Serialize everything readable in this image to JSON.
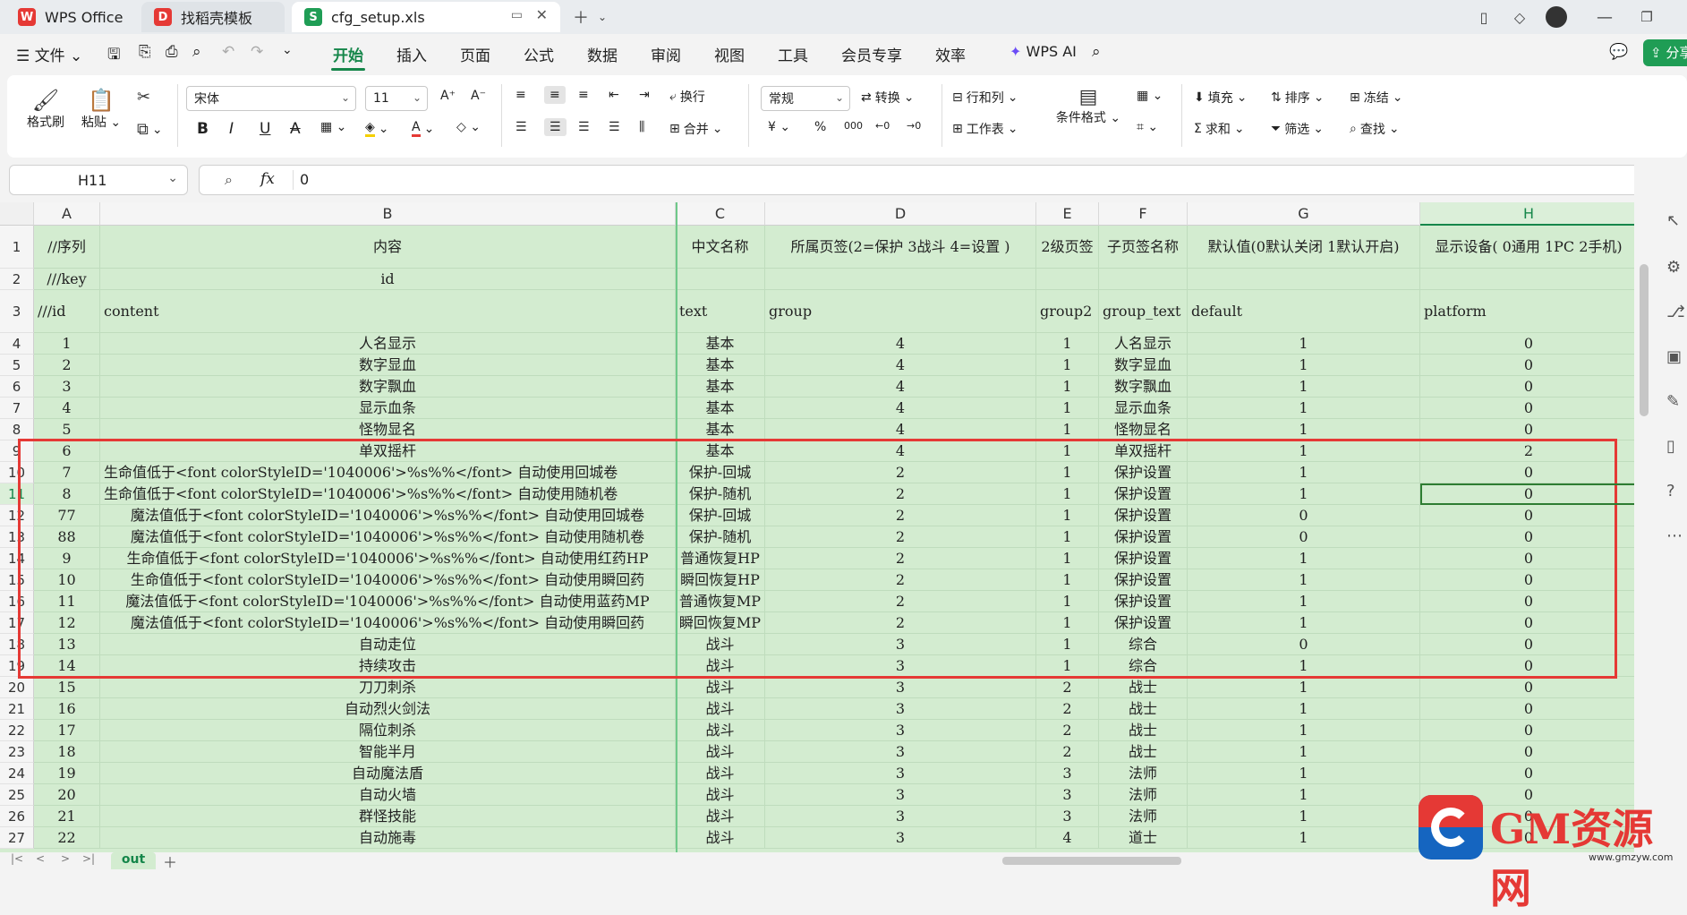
{
  "tabs": [
    {
      "label": "WPS Office"
    },
    {
      "label": "找稻壳模板"
    },
    {
      "label": "cfg_setup.xls"
    }
  ],
  "menu": {
    "file_label": "文件",
    "items": [
      "开始",
      "插入",
      "页面",
      "公式",
      "数据",
      "审阅",
      "视图",
      "工具",
      "会员专享",
      "效率"
    ],
    "wps_ai": "WPS AI",
    "share": "分享"
  },
  "ribbon": {
    "format_painter": "格式刷",
    "paste": "粘贴",
    "font_name": "宋体",
    "font_size": "11",
    "wrap": "换行",
    "merge": "合并",
    "number_format": "常规",
    "convert": "转换",
    "row_col": "行和列",
    "worksheet": "工作表",
    "cond_format": "条件格式",
    "fill": "填充",
    "sort": "排序",
    "freeze": "冻结",
    "sum": "求和",
    "filter": "筛选",
    "find": "查找"
  },
  "formula": {
    "cell_ref": "H11",
    "fx": "fx",
    "value": "0"
  },
  "columns": [
    "A",
    "B",
    "C",
    "D",
    "E",
    "F",
    "G",
    "H"
  ],
  "header_rows": [
    {
      "num": "1",
      "cells": [
        "//序列",
        "内容",
        "中文名称",
        "所属页签(2=保护 3战斗 4=设置 )",
        "2级页签",
        "子页签名称",
        "默认值(0默认关闭 1默认开启)",
        "显示设备( 0通用 1PC 2手机)"
      ]
    },
    {
      "num": "2",
      "cells": [
        "///key",
        "id",
        "",
        "",
        "",
        "",
        "",
        ""
      ]
    },
    {
      "num": "3",
      "cells": [
        "///id",
        "content",
        "text",
        "group",
        "group2",
        "group_text",
        "default",
        "platform"
      ]
    }
  ],
  "rows": [
    {
      "num": "4",
      "cells": [
        "1",
        "人名显示",
        "基本",
        "4",
        "1",
        "人名显示",
        "1",
        "0"
      ]
    },
    {
      "num": "5",
      "cells": [
        "2",
        "数字显血",
        "基本",
        "4",
        "1",
        "数字显血",
        "1",
        "0"
      ]
    },
    {
      "num": "6",
      "cells": [
        "3",
        "数字飘血",
        "基本",
        "4",
        "1",
        "数字飘血",
        "1",
        "0"
      ]
    },
    {
      "num": "7",
      "cells": [
        "4",
        "显示血条",
        "基本",
        "4",
        "1",
        "显示血条",
        "1",
        "0"
      ]
    },
    {
      "num": "8",
      "cells": [
        "5",
        "怪物显名",
        "基本",
        "4",
        "1",
        "怪物显名",
        "1",
        "0"
      ]
    },
    {
      "num": "9",
      "cells": [
        "6",
        "单双摇杆",
        "基本",
        "4",
        "1",
        "单双摇杆",
        "1",
        "2"
      ]
    },
    {
      "num": "10",
      "cells": [
        "7",
        "生命值低于<font colorStyleID='1040006'>%s%%</font> 自动使用回城卷",
        "保护-回城",
        "2",
        "1",
        "保护设置",
        "1",
        "0"
      ]
    },
    {
      "num": "11",
      "cells": [
        "8",
        "生命值低于<font colorStyleID='1040006'>%s%%</font> 自动使用随机卷",
        "保护-随机",
        "2",
        "1",
        "保护设置",
        "1",
        "0"
      ]
    },
    {
      "num": "12",
      "cells": [
        "77",
        "魔法值低于<font colorStyleID='1040006'>%s%%</font> 自动使用回城卷",
        "保护-回城",
        "2",
        "1",
        "保护设置",
        "0",
        "0"
      ]
    },
    {
      "num": "13",
      "cells": [
        "88",
        "魔法值低于<font colorStyleID='1040006'>%s%%</font> 自动使用随机卷",
        "保护-随机",
        "2",
        "1",
        "保护设置",
        "0",
        "0"
      ]
    },
    {
      "num": "14",
      "cells": [
        "9",
        "生命值低于<font colorStyleID='1040006'>%s%%</font> 自动使用红药HP",
        "普通恢复HP",
        "2",
        "1",
        "保护设置",
        "1",
        "0"
      ]
    },
    {
      "num": "15",
      "cells": [
        "10",
        "生命值低于<font colorStyleID='1040006'>%s%%</font> 自动使用瞬回药",
        "瞬回恢复HP",
        "2",
        "1",
        "保护设置",
        "1",
        "0"
      ]
    },
    {
      "num": "16",
      "cells": [
        "11",
        "魔法值低于<font colorStyleID='1040006'>%s%%</font> 自动使用蓝药MP",
        "普通恢复MP",
        "2",
        "1",
        "保护设置",
        "1",
        "0"
      ]
    },
    {
      "num": "17",
      "cells": [
        "12",
        "魔法值低于<font colorStyleID='1040006'>%s%%</font> 自动使用瞬回药",
        "瞬回恢复MP",
        "2",
        "1",
        "保护设置",
        "1",
        "0"
      ]
    },
    {
      "num": "18",
      "cells": [
        "13",
        "自动走位",
        "战斗",
        "3",
        "1",
        "综合",
        "0",
        "0"
      ]
    },
    {
      "num": "19",
      "cells": [
        "14",
        "持续攻击",
        "战斗",
        "3",
        "1",
        "综合",
        "1",
        "0"
      ]
    },
    {
      "num": "20",
      "cells": [
        "15",
        "刀刀刺杀",
        "战斗",
        "3",
        "2",
        "战士",
        "1",
        "0"
      ]
    },
    {
      "num": "21",
      "cells": [
        "16",
        "自动烈火剑法",
        "战斗",
        "3",
        "2",
        "战士",
        "1",
        "0"
      ]
    },
    {
      "num": "22",
      "cells": [
        "17",
        "隔位刺杀",
        "战斗",
        "3",
        "2",
        "战士",
        "1",
        "0"
      ]
    },
    {
      "num": "23",
      "cells": [
        "18",
        "智能半月",
        "战斗",
        "3",
        "2",
        "战士",
        "1",
        "0"
      ]
    },
    {
      "num": "24",
      "cells": [
        "19",
        "自动魔法盾",
        "战斗",
        "3",
        "3",
        "法师",
        "1",
        "0"
      ]
    },
    {
      "num": "25",
      "cells": [
        "20",
        "自动火墙",
        "战斗",
        "3",
        "3",
        "法师",
        "1",
        "0"
      ]
    },
    {
      "num": "26",
      "cells": [
        "21",
        "群怪技能",
        "战斗",
        "3",
        "3",
        "法师",
        "1",
        "0"
      ]
    },
    {
      "num": "27",
      "cells": [
        "22",
        "自动施毒",
        "战斗",
        "3",
        "4",
        "道士",
        "1",
        "0"
      ]
    }
  ],
  "sheet": {
    "active_tab": "out"
  },
  "watermark": {
    "text": "GM资源网",
    "url": "www.gmzyw.com"
  },
  "colors": {
    "accent": "#15864a",
    "grid_fill": "#d3ecd0",
    "highlight": "#e53935"
  }
}
